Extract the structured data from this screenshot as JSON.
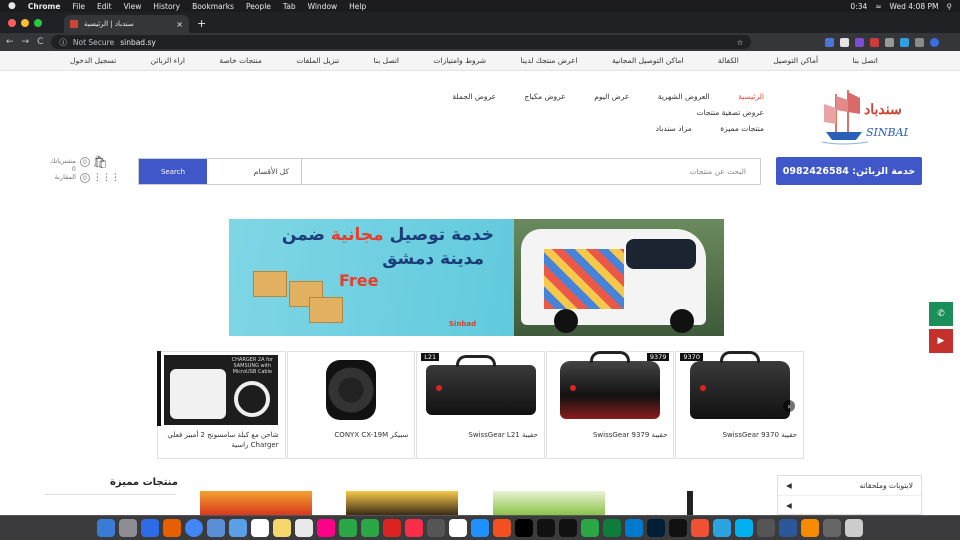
{
  "macbar": {
    "apple": "",
    "app": "Chrome",
    "menus": [
      "File",
      "Edit",
      "View",
      "History",
      "Bookmarks",
      "People",
      "Tab",
      "Window",
      "Help"
    ],
    "time": "0:34",
    "clock": "Wed 4:08 PM"
  },
  "tab": {
    "title": "سندباد | الرئيسية",
    "close": "×",
    "new": "+"
  },
  "address": {
    "back": "←",
    "forward": "→",
    "reload": "C",
    "security": "Not Secure",
    "url": "sinbad.sy",
    "star": "☆"
  },
  "topnav": {
    "items": [
      "اتصل بنا",
      "أماكن التوصيل",
      "الكفالة",
      "اماكن التوصيل المجانية",
      "اعرض منتجك لدينا",
      "شروط وامتيازات",
      "اتصل بنا",
      "تنزيل الملفات",
      "منتجات خاصة",
      "اراء الزبائن",
      "تسجيل الدخول"
    ]
  },
  "logo": {
    "text": "SINBAD"
  },
  "mainmenu": {
    "row1": [
      "الرئيسية",
      "العروض الشهرية",
      "عرض اليوم",
      "عروض مكياج",
      "عروض الجملة",
      "عروض تصفية منتجات"
    ],
    "row2": [
      "منتجات مميزة",
      "مزاد سندباد"
    ]
  },
  "hotline": {
    "label": "خدمة الزبائن: 0982426584"
  },
  "search": {
    "placeholder": "البحث عن منتجات",
    "category": "كل الأقسام",
    "button": "Search"
  },
  "minicart": {
    "wishlist_label": "مشترياتك",
    "wishlist_count": "0",
    "cart_count": "0",
    "total": "0",
    "compare_label": "المقارنة",
    "compare_count": "0"
  },
  "banner": {
    "line1_pre": "خدمة توصيل",
    "line1_highlight": "مجانية",
    "line1_post": "ضمن",
    "line2": "مدينة دمشق",
    "line3": "Free",
    "brand": "Sinbad"
  },
  "products": [
    {
      "name": "حقيبة SwissGear 9370",
      "tag": "9370"
    },
    {
      "name": "حقيبة SwissGear 9379",
      "tag": "9379"
    },
    {
      "name": "حقيبة SwissGear L21",
      "tag": "L21"
    },
    {
      "name": "سبيكر CONYX CX-19M",
      "tag": ""
    },
    {
      "name": "شاحن مع كبلة سامسونج 2 أمبير فعلي Charger راسية",
      "tag": "",
      "image_text": "CHARGER 2A for SAMSUNG with MicroUSB Cable"
    }
  ],
  "featured": {
    "title": "منتجات مميزة"
  },
  "categories": [
    {
      "label": "لابتوبات وملحقاته"
    }
  ],
  "social": [
    "whatsapp-icon",
    "youtube-icon"
  ],
  "colors": {
    "accent": "#3f57c8",
    "active_menu": "#e74c3c",
    "whatsapp": "#1b8f5a",
    "youtube": "#c4302b"
  }
}
